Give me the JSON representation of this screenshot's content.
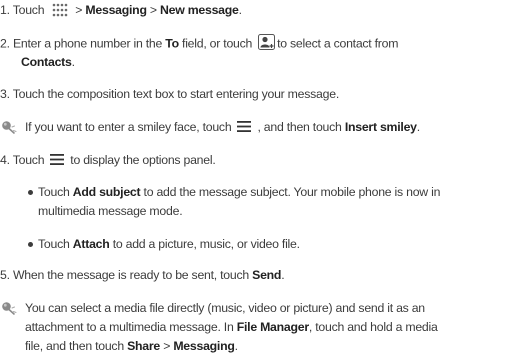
{
  "steps": [
    {
      "number": "1.",
      "prefix": "Touch",
      "path_sep": ">",
      "menu_messaging": "Messaging",
      "sep2": ">",
      "new_message": "New message",
      "end": "."
    },
    {
      "number": "2.",
      "text_a": "Enter a phone number in the",
      "to_field": "To",
      "text_b": "field, or touch",
      "text_c": "to select a contact from",
      "contacts": "Contacts",
      "end": "."
    },
    {
      "number": "3.",
      "text": "Touch the composition text box to start entering your message."
    },
    {
      "number": "4.",
      "prefix": "Touch",
      "text": "to display the options panel."
    },
    {
      "number": "5.",
      "text": "When the message is ready to be sent, touch",
      "send": "Send",
      "end": "."
    }
  ],
  "tip_smiley": {
    "text_a": "If you want to enter a smiley face, touch",
    "text_b": ", and then touch",
    "insert_smiley": "Insert smiley",
    "end": "."
  },
  "bullets": [
    {
      "prefix": "Touch",
      "bold": "Add subject",
      "line1": "to add the message subject. Your mobile phone is now in",
      "line2": "multimedia message mode."
    },
    {
      "prefix": "Touch",
      "bold": "Attach",
      "text": "to add a picture, music, or video file."
    }
  ],
  "tip_media": {
    "line1": "You can select a media file directly (music, video or picture) and send it as an",
    "line2_a": "attachment to a multimedia message. In",
    "file_manager": "File Manager",
    "line2_b": ", touch and hold a media",
    "line3_a": "file, and then touch",
    "share": "Share",
    "sep": ">",
    "messaging": "Messaging",
    "end": "."
  },
  "icons": {
    "apps": "app-grid-icon",
    "contact": "contact-picker-icon",
    "menu": "menu-icon",
    "tip": "tip-lightbulb-icon"
  },
  "colors": {
    "text": "#3c3c3c",
    "bold_text": "#222222",
    "icon_gray": "#8a8a8a"
  }
}
